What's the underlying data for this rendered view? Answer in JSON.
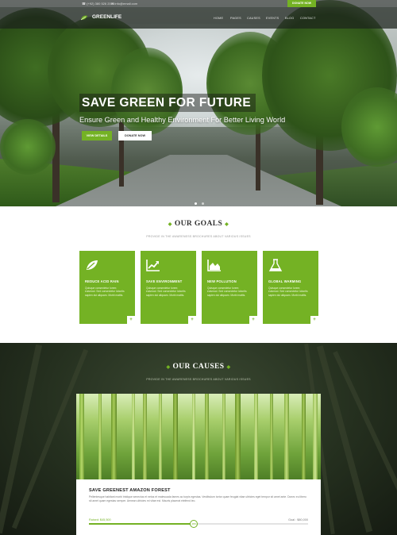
{
  "topbar": {
    "phone": "(+92) 380 526 2090",
    "email": "info@email.com",
    "donate_label": "DONATE NOW"
  },
  "header": {
    "logo_text": "GREENLIFE",
    "nav": [
      "HOME",
      "PAGES",
      "CAUSES",
      "EVENTS",
      "BLOG",
      "CONTACT"
    ]
  },
  "hero": {
    "title": "SAVE GREEN FOR FUTURE",
    "subtitle": "Ensure Green and Healthy Environment For Better Living World",
    "btn_primary": "VIEW DETAILS",
    "btn_secondary": "DONATE NOW",
    "slides": 2,
    "active_slide": 1
  },
  "goals": {
    "title": "OUR GOALS",
    "subtitle": "PROVIDE IN THE AWARENESS BROCHURES ABOUT VARIOUS ISSUES",
    "items": [
      {
        "icon": "leaf-icon",
        "title": "REDUCE ACID RAIN",
        "text": "Quisque consectetur lorem euismod. Sed consectetur lobortis sapien dui aliquam. Morbi mattis."
      },
      {
        "icon": "trend-up-icon",
        "title": "SAVE ENVIRONMENT",
        "text": "Quisque consectetur lorem euismod. Sed consectetur lobortis sapien dui aliquam. Morbi mattis."
      },
      {
        "icon": "area-chart-icon",
        "title": "NEW POLLUTION",
        "text": "Quisque consectetur lorem euismod. Sed consectetur lobortis sapien dui aliquam. Morbi mattis."
      },
      {
        "icon": "flask-icon",
        "title": "GLOBAL WARMING",
        "text": "Quisque consectetur lorem euismod. Sed consectetur lobortis sapien dui aliquam. Morbi mattis."
      }
    ],
    "plus": "+"
  },
  "causes": {
    "title": "OUR CAUSES",
    "subtitle": "PROVIDE IN THE AWARENESS BROCHURES ABOUT VARIOUS ISSUES",
    "card": {
      "title": "SAVE GREENEST AMAZON FOREST",
      "text": "Pellentesque habitant morbi tristique senectus et netus et malesuada fames ac turpis egestas. Vestibulum tortor quam feugiat vitae ultricies eget tempor sit amet ante. Donec eu libero sit amet quam egestas semper. Aenean ultricies mi vitae est. Mauris placerat eleifend leo.",
      "raised_label": "Raised: $45,500",
      "goal_label": "Goal : $80,000",
      "progress_percent": 48,
      "knob_text": "48%"
    }
  },
  "colors": {
    "accent": "#74b224",
    "dark": "#25301f"
  }
}
